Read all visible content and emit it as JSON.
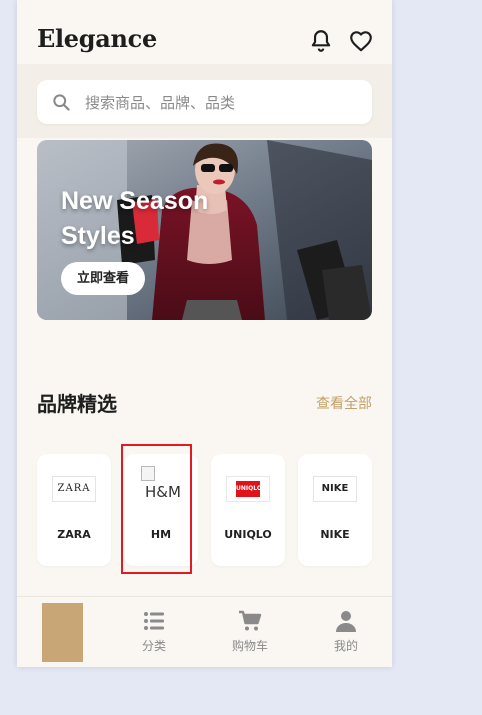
{
  "app": {
    "title": "Elegance"
  },
  "header": {
    "icons": [
      "bell-icon",
      "heart-icon"
    ]
  },
  "search": {
    "placeholder": "搜索商品、品牌、品类"
  },
  "banner": {
    "title": "New Season Styles",
    "button_label": "立即查看"
  },
  "brands": {
    "title": "品牌精选",
    "see_all_label": "查看全部",
    "items": [
      {
        "name": "ZARA",
        "logo_text": "ZARA"
      },
      {
        "name": "HM",
        "logo_alt": "H&M"
      },
      {
        "name": "UNIQLO",
        "logo_text": "UNIQLO"
      },
      {
        "name": "NIKE",
        "logo_text": "NIKE"
      }
    ]
  },
  "tabbar": {
    "items": [
      {
        "label": "",
        "icon": "home-icon"
      },
      {
        "label": "分类",
        "icon": "list-icon"
      },
      {
        "label": "购物车",
        "icon": "cart-icon"
      },
      {
        "label": "我的",
        "icon": "user-icon"
      }
    ]
  },
  "colors": {
    "background": "#faf7f2",
    "accent": "#c2a06a",
    "tab_active": "#c9a676",
    "highlight": "#e01b24"
  }
}
